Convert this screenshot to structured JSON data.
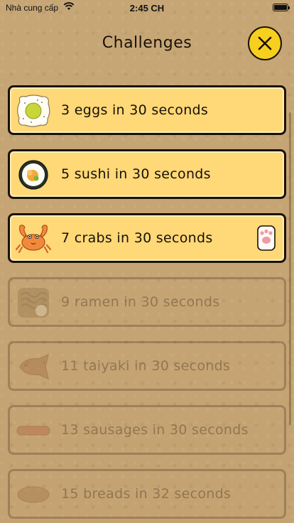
{
  "status_bar": {
    "carrier": "Nhà cung cấp",
    "time": "2:45 CH"
  },
  "header": {
    "title": "Challenges",
    "close_icon": "close-x-icon"
  },
  "challenges": [
    {
      "label": "3 eggs in 30 seconds",
      "icon": "egg-icon",
      "unlocked": true
    },
    {
      "label": "5 sushi in 30 seconds",
      "icon": "sushi-icon",
      "unlocked": true
    },
    {
      "label": "7 crabs in 30 seconds",
      "icon": "crab-icon",
      "unlocked": true,
      "badge": "paw-icon"
    },
    {
      "label": "9 ramen in 30 seconds",
      "icon": "ramen-icon",
      "unlocked": false
    },
    {
      "label": "11 taiyaki in 30 seconds",
      "icon": "taiyaki-icon",
      "unlocked": false
    },
    {
      "label": "13 sausages in 30 seconds",
      "icon": "sausage-icon",
      "unlocked": false
    },
    {
      "label": "15 breads in 32 seconds",
      "icon": "bread-icon",
      "unlocked": false
    }
  ],
  "colors": {
    "card_active": "#ffd877",
    "close_button": "#f7cf1e",
    "background": "#c9a878"
  }
}
